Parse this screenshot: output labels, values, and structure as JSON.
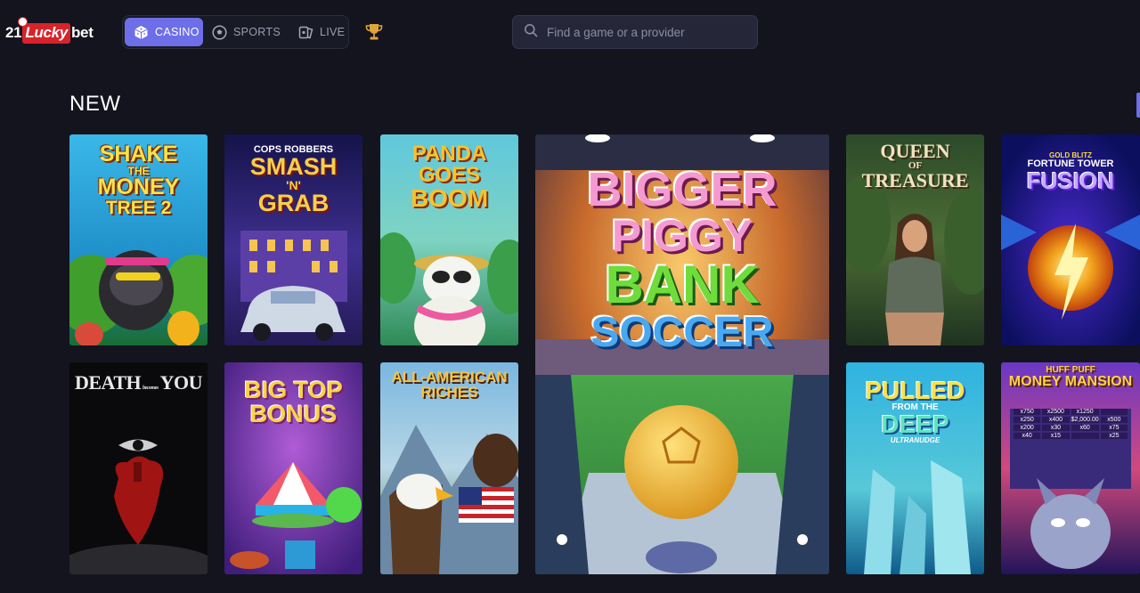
{
  "brand": {
    "num": "21",
    "lucky": "Lucky",
    "bet": "bet"
  },
  "nav": [
    {
      "label": "CASINO",
      "icon": "dice-icon",
      "active": true
    },
    {
      "label": "SPORTS",
      "icon": "soccer-ball-icon",
      "active": false
    },
    {
      "label": "LIVE",
      "icon": "cards-icon",
      "active": false
    }
  ],
  "search": {
    "placeholder": "Find a game or a provider"
  },
  "section": {
    "title": "NEW"
  },
  "games": [
    {
      "id": "shake",
      "lines": [
        "SHAKE",
        "THE",
        "MONEY",
        "TREE 2"
      ]
    },
    {
      "id": "smash",
      "lines": [
        "COPS",
        "ROBBERS",
        "SMASH",
        "'N'",
        "GRAB"
      ]
    },
    {
      "id": "panda",
      "lines": [
        "PANDA GOES",
        "BOOM"
      ]
    },
    {
      "id": "piggy",
      "lines": [
        "BIGGER",
        "PIGGY",
        "BANK",
        "SOCCER"
      ]
    },
    {
      "id": "queen",
      "lines": [
        "QUEEN",
        "OF",
        "TREASURE"
      ]
    },
    {
      "id": "fusion",
      "lines": [
        "GOLD",
        "BLITZ",
        "FORTUNE TOWER",
        "FUSION"
      ]
    },
    {
      "id": "death",
      "lines": [
        "DEATH",
        "becomes",
        "YOU"
      ]
    },
    {
      "id": "bigtop",
      "lines": [
        "BIG TOP",
        "BONUS"
      ]
    },
    {
      "id": "american",
      "lines": [
        "ALL-AMERICAN",
        "RICHES"
      ]
    },
    {
      "id": "deep",
      "lines": [
        "PULLED",
        "FROM THE",
        "DEEP",
        "ULTRANUDGE"
      ]
    },
    {
      "id": "mansion",
      "lines": [
        "HUFF",
        "PUFF",
        "MONEY MANSION"
      ],
      "multipliers": [
        "x750",
        "x2500",
        "x1250",
        "x250",
        "x400",
        "$2,000.00",
        "x500",
        "x200",
        "x30",
        "x60",
        "x75",
        "x40",
        "x15",
        "x25"
      ]
    }
  ]
}
